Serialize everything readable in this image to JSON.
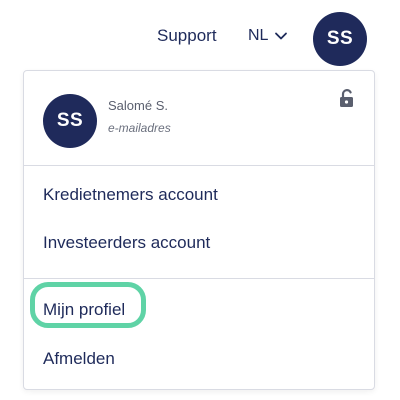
{
  "header": {
    "support_label": "Support",
    "language": {
      "selected": "NL",
      "icon": "chevron-down-icon"
    },
    "avatar_initials": "SS"
  },
  "menu": {
    "user": {
      "avatar_initials": "SS",
      "name": "Salomé S.",
      "email_placeholder": "e-mailadres",
      "lock_icon": "unlock-icon"
    },
    "items": [
      {
        "label": "Kredietnemers account"
      },
      {
        "label": "Investeerders account"
      },
      {
        "label": "Mijn profiel",
        "highlighted": true
      },
      {
        "label": "Afmelden"
      }
    ]
  },
  "colors": {
    "primary_navy": "#1f2a5b",
    "text": "#1e2a5a",
    "highlight": "#5fd3a6",
    "border": "#d9dbe3"
  }
}
